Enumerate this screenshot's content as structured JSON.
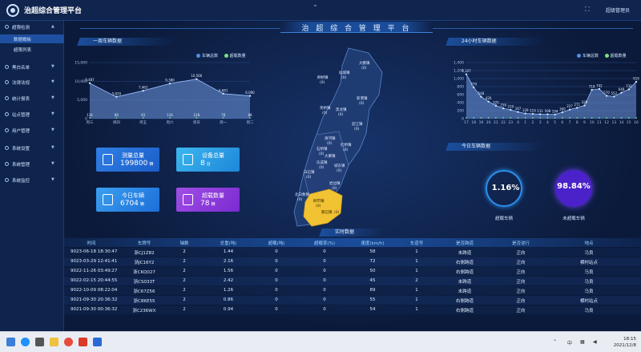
{
  "app": {
    "title": "治超综合管理平台",
    "user": "超级管理员",
    "header_title": "治 超 综 合 管 理 平 台"
  },
  "sidebar": {
    "items": [
      {
        "label": "超限检测",
        "expanded": true,
        "icon": "monitor-icon"
      },
      {
        "label": "黑白名单",
        "icon": "list-icon"
      },
      {
        "label": "法律法规",
        "icon": "book-icon"
      },
      {
        "label": "统计报表",
        "icon": "chart-icon"
      },
      {
        "label": "站点管理",
        "icon": "location-icon"
      },
      {
        "label": "用户管理",
        "icon": "user-icon"
      },
      {
        "label": "系统设置",
        "icon": "gear-icon"
      },
      {
        "label": "系统管理",
        "icon": "settings-icon"
      },
      {
        "label": "系统监控",
        "icon": "eye-icon"
      }
    ],
    "subitems": [
      {
        "label": "数据概板",
        "active": true
      },
      {
        "label": "超限列表",
        "active": false
      }
    ]
  },
  "week_panel": {
    "title": "一周车辆数据"
  },
  "hour_panel": {
    "title": "24小时车辆数据"
  },
  "today_panel": {
    "title": "今日车辆数据"
  },
  "table_panel": {
    "title": "实时数据"
  },
  "chart_data": [
    {
      "type": "area",
      "x": [
        "周三",
        "周四",
        "周五",
        "周六",
        "周日",
        "周一"
      ],
      "series": [
        {
          "name": "车辆总数",
          "values": [
            9487,
            5829,
            7462,
            9380,
            10566,
            6051
          ]
        }
      ],
      "y_ticks": [
        "0",
        "5,000",
        "10,000",
        "15,000"
      ],
      "ylim": [
        0,
        15000
      ],
      "legend": "top-right",
      "grid": true
    },
    {
      "type": "area",
      "x": [
        "17",
        "18",
        "19",
        "20",
        "21",
        "22",
        "23",
        "0",
        "1",
        "2",
        "3",
        "4",
        "5",
        "6",
        "7",
        "8",
        "9",
        "10",
        "11",
        "12",
        "13",
        "14",
        "15",
        "16"
      ],
      "series": [
        {
          "name": "车辆总数",
          "values": [
            1107,
            779,
            548,
            426,
            325,
            258,
            219,
            167,
            129,
            119,
            111,
            108,
            104,
            160,
            227,
            271,
            329,
            718,
            742,
            570,
            552,
            648,
            732,
            919
          ]
        }
      ],
      "y_ticks": [
        "0",
        "200",
        "400",
        "600",
        "800",
        "1,000",
        "1,200",
        "1,400"
      ],
      "ylim": [
        0,
        1400
      ],
      "legend": "top-right",
      "grid": true
    }
  ],
  "week_overlimit_labels": [
    "134",
    "86",
    "93",
    "116",
    "128",
    "78",
    "88"
  ],
  "week_total_labels": [
    "9,487",
    "5,829",
    "7,462",
    "9,380",
    "10,566",
    "6,681",
    "6,090"
  ],
  "week_x_labels": [
    "周三",
    "周四",
    "周五",
    "周六",
    "周日",
    "周一",
    "周二"
  ],
  "hour_total_labels": [
    "1,107",
    "779",
    "548",
    "426",
    "325",
    "258",
    "219",
    "167",
    "129",
    "119",
    "111",
    "108",
    "104",
    "160",
    "227",
    "271",
    "329",
    "718",
    "742",
    "570",
    "552",
    "648",
    "732",
    "919"
  ],
  "legend": {
    "total": "车辆总数",
    "over": "超载数量",
    "total_color": "#4f8ee8",
    "over_color": "#7be07b"
  },
  "stats": [
    {
      "label": "测量总量",
      "value": "199800",
      "unit": "辆",
      "color": "#2f7fe6"
    },
    {
      "label": "设备总量",
      "value": "8",
      "unit": "台",
      "color": "#2fa8e6"
    },
    {
      "label": "今日车辆",
      "value": "6704",
      "unit": "辆",
      "color": "#2f8ee8"
    },
    {
      "label": "超载数量",
      "value": "78",
      "unit": "辆",
      "color": "#8a3fd8"
    }
  ],
  "gauges": [
    {
      "value": "1.16%",
      "label": "超载车辆",
      "fill": "#0b1a3a"
    },
    {
      "value": "98.84%",
      "label": "未超载车辆",
      "fill": "#4b22c9"
    }
  ],
  "map": {
    "regions": [
      {
        "name": "大鹏镇",
        "count": "(0)"
      },
      {
        "name": "仙城镇",
        "count": "(0)"
      },
      {
        "name": "柳桥镇",
        "count": "(0)"
      },
      {
        "name": "新港镇",
        "count": "(0)"
      },
      {
        "name": "黑龙镇",
        "count": "(0)"
      },
      {
        "name": "英桥镇",
        "count": "(0)"
      },
      {
        "name": "迎江镇",
        "count": "(0)"
      },
      {
        "name": "清河镇",
        "count": "(0)"
      },
      {
        "name": "石桥镇",
        "count": "(0)"
      },
      {
        "name": "大寨镇",
        "count": "(0)"
      },
      {
        "name": "红桥镇",
        "count": "(0)"
      },
      {
        "name": "乐成镇",
        "count": "(0)"
      },
      {
        "name": "城东镇",
        "count": "(0)"
      },
      {
        "name": "白石镇",
        "count": "(0)"
      },
      {
        "name": "岩边镇",
        "count": "(0)"
      },
      {
        "name": "北白象镇",
        "count": "(0)"
      },
      {
        "name": "柳市镇",
        "count": "(0)"
      },
      {
        "name": "磐石镇",
        "count": "(0)"
      }
    ]
  },
  "table": {
    "headers": [
      "时间",
      "车牌号",
      "轴数",
      "总重(吨)",
      "超载(吨)",
      "超载率(%)",
      "速度(km/h)",
      "车道号",
      "是否跨道",
      "是否逆行",
      "地点"
    ],
    "rows": [
      [
        "9023-06-18 18:30:47",
        "浙CJ1Z82",
        "2",
        "1.44",
        "0",
        "0",
        "58",
        "1",
        "未跨道",
        "正向",
        "马良"
      ],
      [
        "9023-03-29 12:41:41",
        "浙JC16Y2",
        "2",
        "2.16",
        "0",
        "0",
        "72",
        "1",
        "右侧跨道",
        "正向",
        "横村站点"
      ],
      [
        "9022-11-26 03:49:27",
        "浙CKQ027",
        "2",
        "1.56",
        "0",
        "0",
        "50",
        "1",
        "右侧跨道",
        "正向",
        "马良"
      ],
      [
        "9022-02-15 20:44:55",
        "浙CS033T",
        "2",
        "2.42",
        "0",
        "0",
        "45",
        "2",
        "未跨道",
        "正向",
        "马良"
      ],
      [
        "9022-10-09 08:22:04",
        "浙C67Z56",
        "2",
        "1.26",
        "0",
        "0",
        "89",
        "1",
        "未跨道",
        "正向",
        "马良"
      ],
      [
        "9021-09-30 20:36:32",
        "浙C8KE55",
        "2",
        "0.86",
        "0",
        "0",
        "55",
        "1",
        "右侧跨道",
        "正向",
        "横村站点"
      ],
      [
        "9021-09-30 00:36:32",
        "浙C236WX",
        "2",
        "0.94",
        "0",
        "0",
        "54",
        "1",
        "右侧跨道",
        "正向",
        "马良"
      ]
    ]
  },
  "taskbar": {
    "tray_lang": "中",
    "time": "18:15",
    "date": "2021/12/8"
  }
}
